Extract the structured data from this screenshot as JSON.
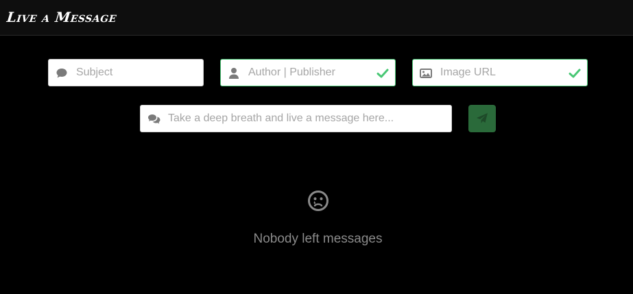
{
  "app": {
    "title": "Live a Message"
  },
  "form": {
    "subject": {
      "placeholder": "Subject",
      "icon": "comment-icon"
    },
    "author": {
      "placeholder": "Author | Publisher",
      "icon": "user-icon",
      "valid": true
    },
    "image_url": {
      "placeholder": "Image URL",
      "icon": "image-icon",
      "valid": true
    },
    "message": {
      "placeholder": "Take a deep breath and live a message here...",
      "icon": "comments-icon"
    },
    "send": {
      "icon": "paper-plane-icon"
    }
  },
  "empty_state": {
    "icon": "sad-tear-icon",
    "text": "Nobody left messages"
  },
  "colors": {
    "background": "#000000",
    "navbar": "#0e0e0e",
    "valid_border": "#48c774",
    "send_button": "#2a6a3a",
    "muted_text": "#8a8a8a"
  }
}
